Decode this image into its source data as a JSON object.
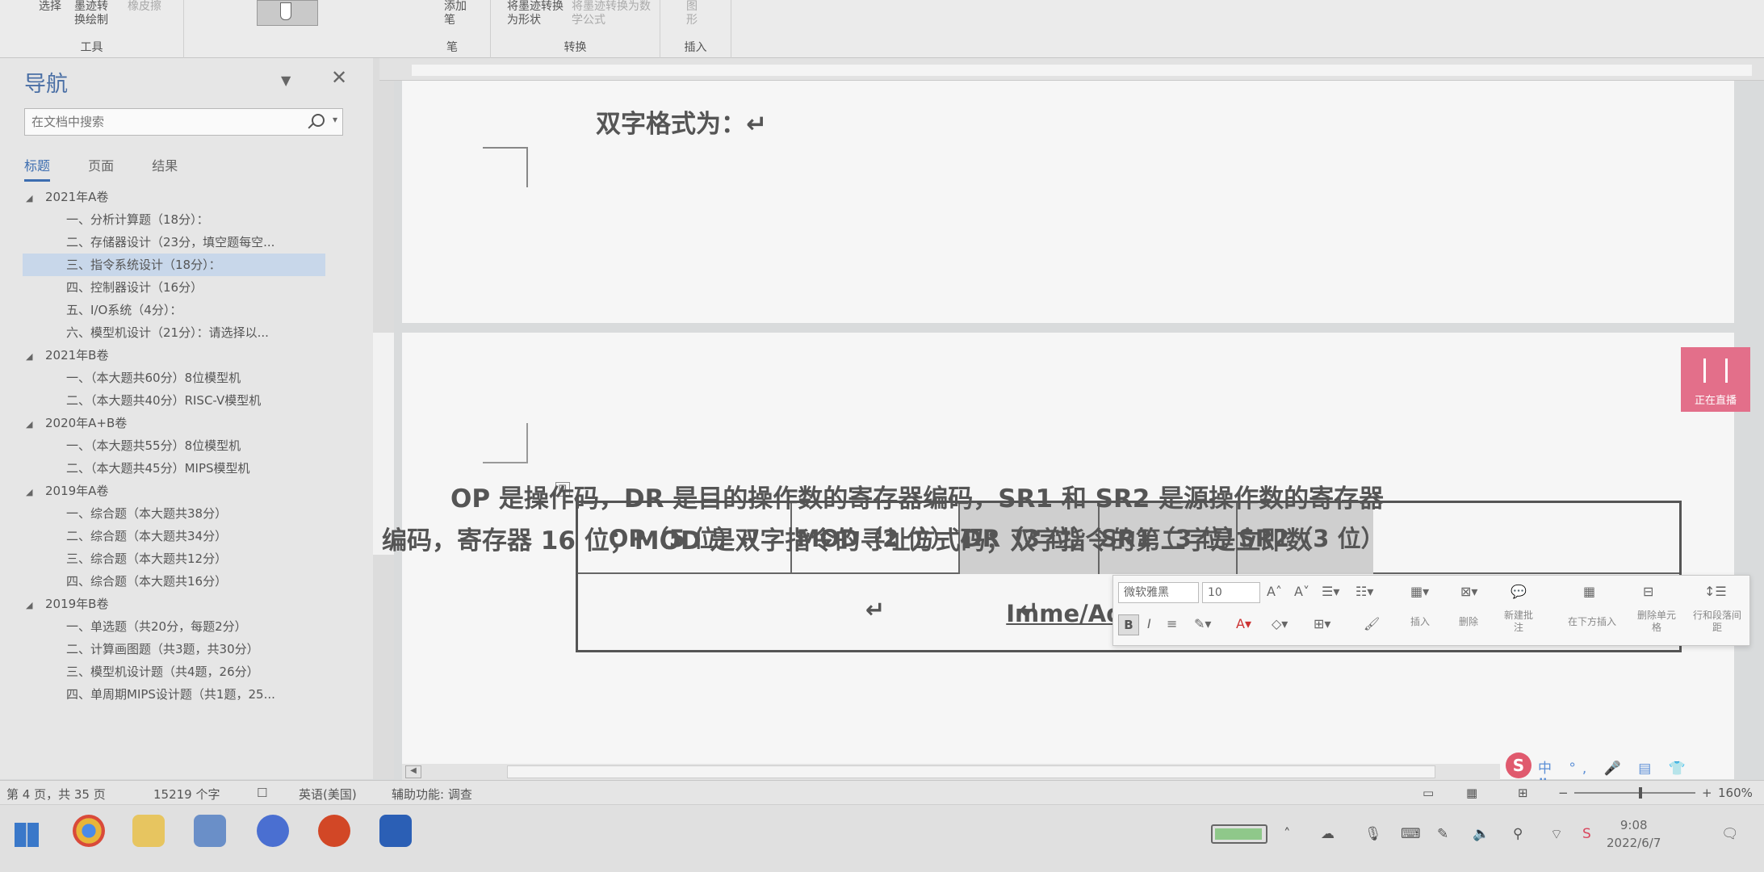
{
  "ribbon": {
    "groups": [
      {
        "name": "工具",
        "buttons": [
          "选择",
          "墨迹转",
          "换绘制",
          "橡皮擦"
        ]
      },
      {
        "name": "笔",
        "buttons": [
          "添加笔"
        ]
      },
      {
        "name": "转换",
        "buttons": [
          "将墨迹转换为形状",
          "将墨迹转换为数学公式"
        ]
      },
      {
        "name": "插入",
        "buttons": [
          "图形"
        ]
      }
    ]
  },
  "nav": {
    "title": "导航",
    "search_placeholder": "在文档中搜索",
    "tabs": [
      "标题",
      "页面",
      "结果"
    ],
    "tree": [
      {
        "level": 0,
        "label": "2021年A卷"
      },
      {
        "level": 1,
        "label": "一、分析计算题（18分）："
      },
      {
        "level": 1,
        "label": "二、存储器设计（23分，填空题每空..."
      },
      {
        "level": 1,
        "label": "三、指令系统设计（18分）：",
        "selected": true
      },
      {
        "level": 1,
        "label": "四、控制器设计（16分）"
      },
      {
        "level": 1,
        "label": "五、I/O系统（4分）："
      },
      {
        "level": 1,
        "label": "六、模型机设计（21分）：请选择以..."
      },
      {
        "level": 0,
        "label": "2021年B卷"
      },
      {
        "level": 1,
        "label": "一、（本大题共60分）8位模型机"
      },
      {
        "level": 1,
        "label": "二、（本大题共40分）RISC-V模型机"
      },
      {
        "level": 0,
        "label": "2020年A+B卷"
      },
      {
        "level": 1,
        "label": "一、（本大题共55分）8位模型机"
      },
      {
        "level": 1,
        "label": "二、（本大题共45分）MIPS模型机"
      },
      {
        "level": 0,
        "label": "2019年A卷"
      },
      {
        "level": 1,
        "label": "一、综合题（本大题共38分）"
      },
      {
        "level": 1,
        "label": "二、综合题（本大题共34分）"
      },
      {
        "level": 1,
        "label": "三、综合题（本大题共12分）"
      },
      {
        "level": 1,
        "label": "四、综合题（本大题共16分）"
      },
      {
        "level": 0,
        "label": "2019年B卷"
      },
      {
        "level": 1,
        "label": "一、单选题（共20分，每题2分）"
      },
      {
        "level": 1,
        "label": "二、计算画图题（共3题，共30分）"
      },
      {
        "level": 1,
        "label": "三、模型机设计题（共4题，26分）"
      },
      {
        "level": 1,
        "label": "四、单周期MIPS设计题（共1题，25..."
      }
    ]
  },
  "document": {
    "heading": "双字格式为：↵",
    "table": {
      "row1": [
        "OP（5 位）↵",
        "MOD（2 位）↵",
        "DR（3 位）↵",
        "SR1（3 位）↵",
        "SR2（3 位）↵"
      ],
      "row2": "Imme/Addr"
    },
    "paragraph_line1": "OP 是操作码，DR 是目的操作数的寄存器编码，SR1 和 SR2 是源操作数的寄存器",
    "paragraph_line2": "编码，寄存器 16 位；MOD 是双字指令的寻址方式码；双字指令的第二字是立即数"
  },
  "mini_toolbar": {
    "font": "微软雅黑",
    "size": "10",
    "labels": [
      "插入",
      "删除",
      "新建批注",
      "在下方插入",
      "删除单元格",
      "行和段落间距"
    ]
  },
  "live_tab": "正在直播",
  "ime": {
    "logo": "S",
    "rest": "中 °, 🎤 ▤ 👕 ⠿"
  },
  "status": {
    "page": "第 4 页，共 35 页",
    "words": "15219 个字",
    "language": "英语(美国)",
    "accessibility": "辅助功能: 调查",
    "zoom": "160%"
  },
  "taskbar": {
    "time": "9:08",
    "date": "2022/6/7"
  }
}
